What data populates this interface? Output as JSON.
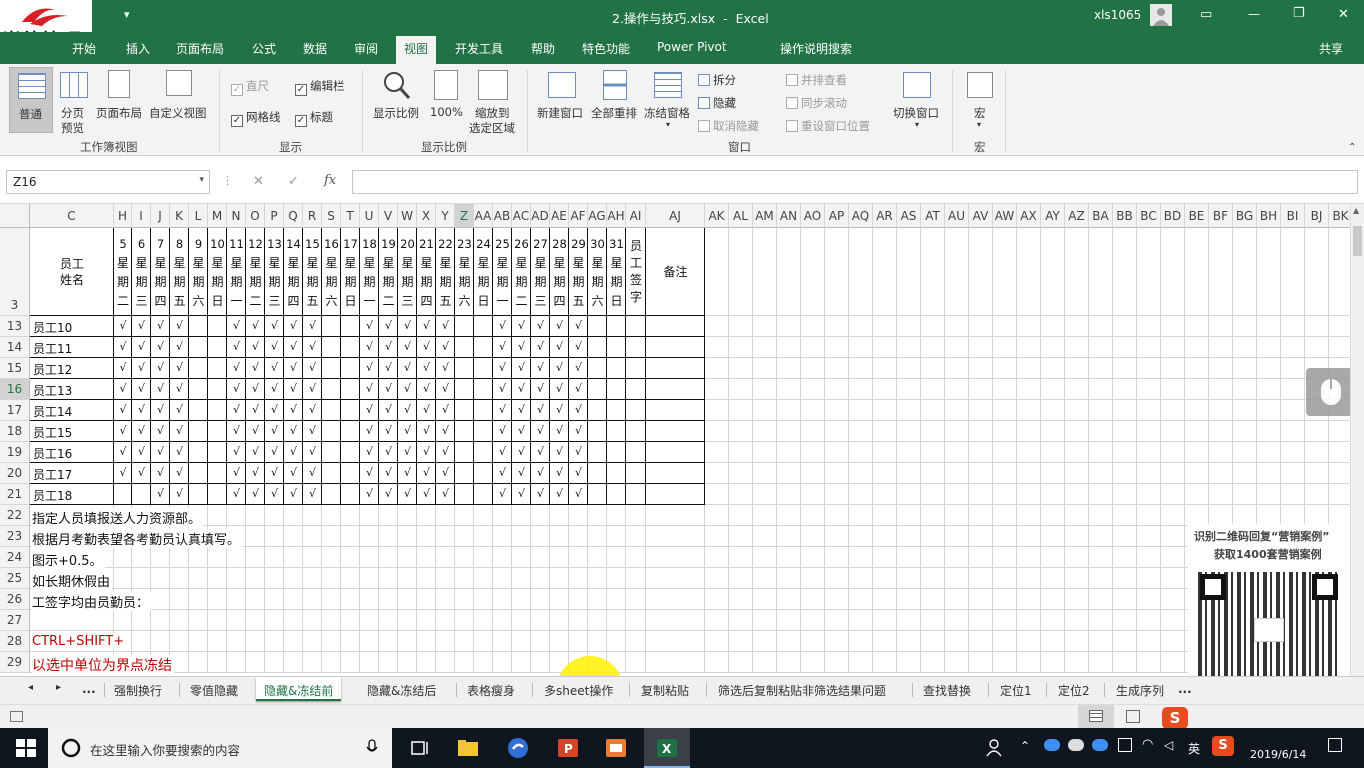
{
  "titlebar": {
    "logo_text": "尚德管理",
    "customize_glyph": "▾",
    "title": "2.操作与技巧.xlsx  -  Excel",
    "user": "xls1065",
    "restore_glyph": "▭",
    "minimize_glyph": "—",
    "maximize_glyph": "❐",
    "close_glyph": "✕"
  },
  "ribbon_tabs": [
    "开始",
    "插入",
    "页面布局",
    "公式",
    "数据",
    "审阅",
    "视图",
    "开发工具",
    "帮助",
    "特色功能",
    "Power Pivot"
  ],
  "ribbon_active_tab": "视图",
  "tell_me": "操作说明搜索",
  "share": "共享",
  "ribbon": {
    "groups": {
      "workbook_views": "工作簿视图",
      "show": "显示",
      "zoom": "显示比例",
      "window": "窗口",
      "macros": "宏"
    },
    "normal": "普通",
    "page_break": [
      "分页",
      "预览"
    ],
    "page_layout": "页面布局",
    "custom_views": "自定义视图",
    "ruler": "直尺",
    "formula_bar": "编辑栏",
    "gridlines": "网格线",
    "headings": "标题",
    "zoom_btn": "显示比例",
    "zoom_100": "100%",
    "zoom_selection": [
      "缩放到",
      "选定区域"
    ],
    "new_window": "新建窗口",
    "arrange_all": "全部重排",
    "freeze_panes": "冻结窗格",
    "split": "拆分",
    "hide": "隐藏",
    "unhide": "取消隐藏",
    "side_by_side": "并排查看",
    "sync_scroll": "同步滚动",
    "reset_pos": "重设窗口位置",
    "switch_windows": "切换窗口",
    "macros_btn": "宏",
    "checked": "✓"
  },
  "formula_bar": {
    "name_box": "Z16",
    "cancel": "✕",
    "enter": "✓",
    "fx": "fx",
    "value": ""
  },
  "columns": [
    "C",
    "H",
    "I",
    "J",
    "K",
    "L",
    "M",
    "N",
    "O",
    "P",
    "Q",
    "R",
    "S",
    "T",
    "U",
    "V",
    "W",
    "X",
    "Y",
    "Z",
    "AA",
    "AB",
    "AC",
    "AD",
    "AE",
    "AF",
    "AG",
    "AH",
    "AI",
    "AJ",
    "AK",
    "AL",
    "AM",
    "AN",
    "AO",
    "AP",
    "AQ",
    "AR",
    "AS",
    "AT",
    "AU",
    "AV",
    "AW",
    "AX",
    "AY",
    "AZ",
    "BA",
    "BB",
    "BC",
    "BD",
    "BE",
    "BF",
    "BG",
    "BH",
    "BI",
    "BJ",
    "BK"
  ],
  "selected_column": "Z",
  "rows": [
    "3",
    "13",
    "14",
    "15",
    "16",
    "17",
    "18",
    "19",
    "20",
    "21",
    "22",
    "23",
    "24",
    "25",
    "26",
    "27",
    "28",
    "29"
  ],
  "selected_row": "16",
  "header_row": {
    "name_label": "员工\n姓名",
    "days": [
      "5",
      "6",
      "7",
      "8",
      "9",
      "10",
      "11",
      "12",
      "13",
      "14",
      "15",
      "16",
      "17",
      "18",
      "19",
      "20",
      "21",
      "22",
      "23",
      "24",
      "25",
      "26",
      "27",
      "28",
      "29",
      "30",
      "31"
    ],
    "weekdays": [
      "二",
      "三",
      "四",
      "五",
      "六",
      "日",
      "一",
      "二",
      "三",
      "四",
      "五",
      "六",
      "日",
      "一",
      "二",
      "三",
      "四",
      "五",
      "六",
      "日",
      "一",
      "二",
      "三",
      "四",
      "五",
      "六",
      "日"
    ],
    "sign_label": "员\n工\n签\n字",
    "remark_label": "备注"
  },
  "employees": [
    {
      "name": "员工10",
      "marks": "11110011111001111100111110"
    },
    {
      "name": "员工11",
      "marks": "11110011111001111100111110"
    },
    {
      "name": "员工12",
      "marks": "11110011111001111100111110"
    },
    {
      "name": "员工13",
      "marks": "11110011111001111100111110"
    },
    {
      "name": "员工14",
      "marks": "11110011111001111100111110"
    },
    {
      "name": "员工15",
      "marks": "11110011111001111100111110"
    },
    {
      "name": "员工16",
      "marks": "11110011111001111100111110"
    },
    {
      "name": "员工17",
      "marks": "11110011111001111100111110"
    },
    {
      "name": "员工18",
      "marks": "00110011111001111100111110"
    }
  ],
  "check_glyph": "√",
  "notes": [
    {
      "text": "指定人员填报送人力资源部。",
      "color": "#111"
    },
    {
      "text": "根据月考勤表望各考勤员认真填写。",
      "color": "#111"
    },
    {
      "text": "图示+0.5。",
      "color": "#111"
    },
    {
      "text": "如长期休假由",
      "color": "#111"
    },
    {
      "text": "工签字均由员勤员：",
      "color": "#111"
    },
    {
      "text": "",
      "color": "#111"
    },
    {
      "text": "CTRL+SHIFT+",
      "color": "#c00000"
    },
    {
      "text": "以选中单位为界点冻结",
      "color": "#c00000"
    }
  ],
  "promo": {
    "line1": "识别二维码回复“营销案例”",
    "line2": "获取1400套营销案例"
  },
  "sheet_tabs": [
    "强制换行",
    "零值隐藏",
    "隐藏&冻结前",
    "隐藏&冻结后",
    "表格瘦身",
    "多sheet操作",
    "复制粘贴",
    "筛选后复制粘贴非筛选结果问题",
    "查找替换",
    "定位1",
    "定位2",
    "生成序列"
  ],
  "active_sheet": "隐藏&冻结前",
  "sheet_nav": [
    "◂",
    "▸",
    "..."
  ],
  "more_tabs": "...",
  "taskbar": {
    "search_placeholder": "在这里输入你要搜索的内容",
    "lang": "英",
    "date": "2019/6/14"
  }
}
